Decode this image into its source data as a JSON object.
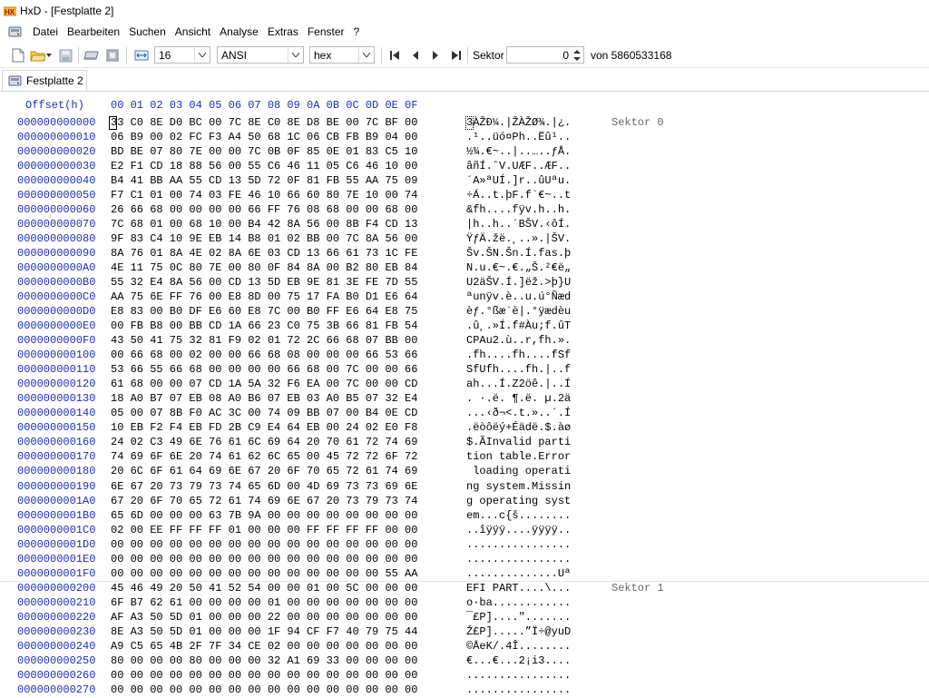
{
  "window": {
    "title": "HxD - [Festplatte 2]"
  },
  "menu": [
    "Datei",
    "Bearbeiten",
    "Suchen",
    "Ansicht",
    "Analyse",
    "Extras",
    "Fenster",
    "?"
  ],
  "toolbar": {
    "bytes_per_row": "16",
    "charset": "ANSI",
    "offset_base": "hex",
    "sector_label": "Sektor",
    "sector_value": "0",
    "sector_total": "von 5860533168"
  },
  "tab": {
    "label": "Festplatte 2"
  },
  "hex_header": {
    "offset_label": "Offset(h)",
    "columns": "00 01 02 03 04 05 06 07 08 09 0A 0B 0C 0D 0E 0F"
  },
  "sector_labels": [
    "Sektor 0",
    "Sektor 1"
  ],
  "rows": [
    {
      "offset": "000000000000",
      "hex": "33 C0 8E D0 BC 00 7C 8E C0 8E D8 BE 00 7C BF 00",
      "ascii": "3ÀŽÐ¼.|ŽÀŽØ¾.|¿."
    },
    {
      "offset": "000000000010",
      "hex": "06 B9 00 02 FC F3 A4 50 68 1C 06 CB FB B9 04 00",
      "ascii": ".¹..üó¤Ph..Ëû¹.."
    },
    {
      "offset": "000000000020",
      "hex": "BD BE 07 80 7E 00 00 7C 0B 0F 85 0E 01 83 C5 10",
      "ascii": "½¾.€~..|..…..ƒÅ."
    },
    {
      "offset": "000000000030",
      "hex": "E2 F1 CD 18 88 56 00 55 C6 46 11 05 C6 46 10 00",
      "ascii": "âñÍ.ˆV.UÆF..ÆF.."
    },
    {
      "offset": "000000000040",
      "hex": "B4 41 BB AA 55 CD 13 5D 72 0F 81 FB 55 AA 75 09",
      "ascii": "´A»ªUÍ.]r..ûUªu."
    },
    {
      "offset": "000000000050",
      "hex": "F7 C1 01 00 74 03 FE 46 10 66 60 80 7E 10 00 74",
      "ascii": "÷Á..t.þF.f`€~..t"
    },
    {
      "offset": "000000000060",
      "hex": "26 66 68 00 00 00 00 66 FF 76 08 68 00 00 68 00",
      "ascii": "&fh....fÿv.h..h."
    },
    {
      "offset": "000000000070",
      "hex": "7C 68 01 00 68 10 00 B4 42 8A 56 00 8B F4 CD 13",
      "ascii": "|h..h..´BŠV.‹ôÍ."
    },
    {
      "offset": "000000000080",
      "hex": "9F 83 C4 10 9E EB 14 B8 01 02 BB 00 7C 8A 56 00",
      "ascii": "ŸƒÄ.žë.¸..».|ŠV."
    },
    {
      "offset": "000000000090",
      "hex": "8A 76 01 8A 4E 02 8A 6E 03 CD 13 66 61 73 1C FE",
      "ascii": "Šv.ŠN.Šn.Í.fas.þ"
    },
    {
      "offset": "0000000000A0",
      "hex": "4E 11 75 0C 80 7E 00 80 0F 84 8A 00 B2 80 EB 84",
      "ascii": "N.u.€~.€.„Š.²€ë„"
    },
    {
      "offset": "0000000000B0",
      "hex": "55 32 E4 8A 56 00 CD 13 5D EB 9E 81 3E FE 7D 55",
      "ascii": "U2äŠV.Í.]ëž.>þ}U"
    },
    {
      "offset": "0000000000C0",
      "hex": "AA 75 6E FF 76 00 E8 8D 00 75 17 FA B0 D1 E6 64",
      "ascii": "ªunÿv.è..u.ú°Ñæd"
    },
    {
      "offset": "0000000000D0",
      "hex": "E8 83 00 B0 DF E6 60 E8 7C 00 B0 FF E6 64 E8 75",
      "ascii": "èƒ.°ßæ`è|.°ÿædèu"
    },
    {
      "offset": "0000000000E0",
      "hex": "00 FB B8 00 BB CD 1A 66 23 C0 75 3B 66 81 FB 54",
      "ascii": ".û¸.»Í.f#Àu;f.ûT"
    },
    {
      "offset": "0000000000F0",
      "hex": "43 50 41 75 32 81 F9 02 01 72 2C 66 68 07 BB 00",
      "ascii": "CPAu2.ù..r,fh.»."
    },
    {
      "offset": "000000000100",
      "hex": "00 66 68 00 02 00 00 66 68 08 00 00 00 66 53 66",
      "ascii": ".fh....fh....fSf"
    },
    {
      "offset": "000000000110",
      "hex": "53 66 55 66 68 00 00 00 00 66 68 00 7C 00 00 66",
      "ascii": "SfUfh....fh.|..f"
    },
    {
      "offset": "000000000120",
      "hex": "61 68 00 00 07 CD 1A 5A 32 F6 EA 00 7C 00 00 CD",
      "ascii": "ah...Í.Z2öê.|..Í"
    },
    {
      "offset": "000000000130",
      "hex": "18 A0 B7 07 EB 08 A0 B6 07 EB 03 A0 B5 07 32 E4",
      "ascii": ". ·.ë. ¶.ë. µ.2ä"
    },
    {
      "offset": "000000000140",
      "hex": "05 00 07 8B F0 AC 3C 00 74 09 BB 07 00 B4 0E CD",
      "ascii": "...‹ð¬<.t.»..´.Í"
    },
    {
      "offset": "000000000150",
      "hex": "10 EB F2 F4 EB FD 2B C9 E4 64 EB 00 24 02 E0 F8",
      "ascii": ".ëòôëý+Éädë.$.àø"
    },
    {
      "offset": "000000000160",
      "hex": "24 02 C3 49 6E 76 61 6C 69 64 20 70 61 72 74 69",
      "ascii": "$.ÃInvalid parti"
    },
    {
      "offset": "000000000170",
      "hex": "74 69 6F 6E 20 74 61 62 6C 65 00 45 72 72 6F 72",
      "ascii": "tion table.Error"
    },
    {
      "offset": "000000000180",
      "hex": "20 6C 6F 61 64 69 6E 67 20 6F 70 65 72 61 74 69",
      "ascii": " loading operati"
    },
    {
      "offset": "000000000190",
      "hex": "6E 67 20 73 79 73 74 65 6D 00 4D 69 73 73 69 6E",
      "ascii": "ng system.Missin"
    },
    {
      "offset": "0000000001A0",
      "hex": "67 20 6F 70 65 72 61 74 69 6E 67 20 73 79 73 74",
      "ascii": "g operating syst"
    },
    {
      "offset": "0000000001B0",
      "hex": "65 6D 00 00 00 63 7B 9A 00 00 00 00 00 00 00 00",
      "ascii": "em...c{š........"
    },
    {
      "offset": "0000000001C0",
      "hex": "02 00 EE FF FF FF 01 00 00 00 FF FF FF FF 00 00",
      "ascii": "..îÿÿÿ....ÿÿÿÿ.."
    },
    {
      "offset": "0000000001D0",
      "hex": "00 00 00 00 00 00 00 00 00 00 00 00 00 00 00 00",
      "ascii": "................"
    },
    {
      "offset": "0000000001E0",
      "hex": "00 00 00 00 00 00 00 00 00 00 00 00 00 00 00 00",
      "ascii": "................"
    },
    {
      "offset": "0000000001F0",
      "hex": "00 00 00 00 00 00 00 00 00 00 00 00 00 00 55 AA",
      "ascii": "..............Uª"
    },
    {
      "offset": "000000000200",
      "hex": "45 46 49 20 50 41 52 54 00 00 01 00 5C 00 00 00",
      "ascii": "EFI PART....\\..."
    },
    {
      "offset": "000000000210",
      "hex": "6F B7 62 61 00 00 00 00 01 00 00 00 00 00 00 00",
      "ascii": "o·ba............"
    },
    {
      "offset": "000000000220",
      "hex": "AF A3 50 5D 01 00 00 00 22 00 00 00 00 00 00 00",
      "ascii": "¯£P]....\"......."
    },
    {
      "offset": "000000000230",
      "hex": "8E A3 50 5D 01 00 00 00 1F 94 CF F7 40 79 75 44",
      "ascii": "Ž£P].....”Ï÷@yuD"
    },
    {
      "offset": "000000000240",
      "hex": "A9 C5 65 4B 2F 7F 34 CE 02 00 00 00 00 00 00 00",
      "ascii": "©ÅeK/.4Î........"
    },
    {
      "offset": "000000000250",
      "hex": "80 00 00 00 80 00 00 00 32 A1 69 33 00 00 00 00",
      "ascii": "€...€...2¡i3...."
    },
    {
      "offset": "000000000260",
      "hex": "00 00 00 00 00 00 00 00 00 00 00 00 00 00 00 00",
      "ascii": "................"
    },
    {
      "offset": "000000000270",
      "hex": "00 00 00 00 00 00 00 00 00 00 00 00 00 00 00 00",
      "ascii": "................"
    }
  ]
}
